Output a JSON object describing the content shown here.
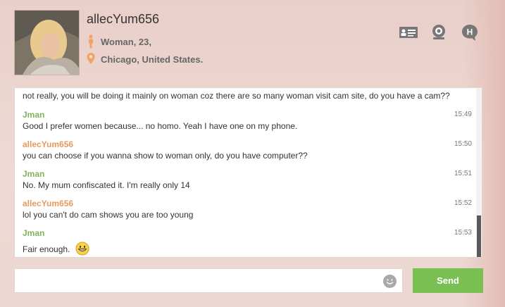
{
  "profile": {
    "username": "allecYum656",
    "gender_age": "Woman, 23,",
    "location": "Chicago, United States.",
    "accent_color": "#f0a462"
  },
  "header_icons": [
    "profile-card-icon",
    "webcam-icon",
    "help-icon"
  ],
  "messages": [
    {
      "sender": "",
      "text": "not really, you will be doing it mainly on woman coz there are so many woman visit cam site, do you have a cam??",
      "time": ""
    },
    {
      "sender": "Jman",
      "text": "Good I prefer women because... no homo. Yeah I have one on my phone.",
      "time": "15:49"
    },
    {
      "sender": "allecYum656",
      "text": "you can choose if you wanna show to woman only, do you have computer??",
      "time": "15:50"
    },
    {
      "sender": "Jman",
      "text": "No. My mum confiscated it. I'm really only 14",
      "time": "15:51"
    },
    {
      "sender": "allecYum656",
      "text": "lol you can't do cam shows you are too young",
      "time": "15:52"
    },
    {
      "sender": "Jman",
      "text": "Fair enough.",
      "time": "15:53"
    }
  ],
  "composer": {
    "placeholder": "",
    "send_label": "Send"
  },
  "colors": {
    "jman": "#7fb45a",
    "allec": "#e79a5b",
    "send_button": "#7abf51"
  }
}
